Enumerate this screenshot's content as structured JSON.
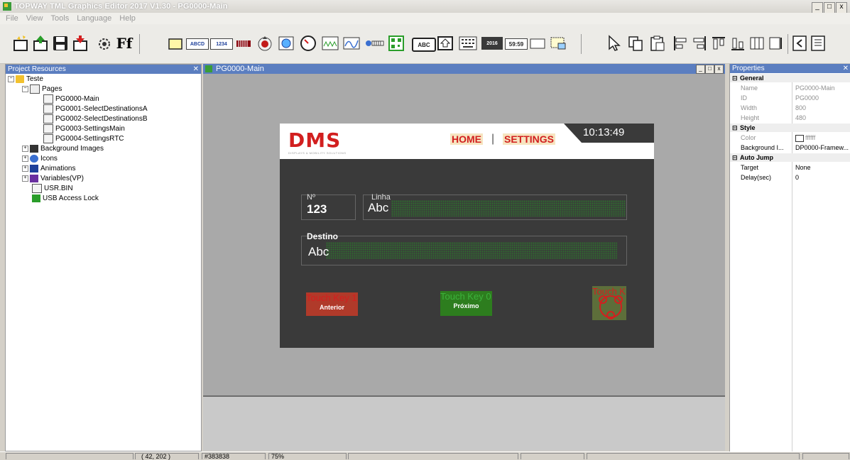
{
  "window": {
    "title": "TOPWAY TML Graphics Editor 2017 V1.30 - PG0000-Main",
    "controls": [
      "_",
      "□",
      "x"
    ]
  },
  "menu": [
    "File",
    "View",
    "Tools",
    "Language",
    "Help"
  ],
  "toolbar": {
    "icons": [
      "new-project-icon",
      "open-project-icon",
      "save-icon",
      "export-icon",
      "settings-icon",
      "font-icon",
      "rect-area-icon",
      "text-abcd-icon",
      "number-1234-icon",
      "bar-icon",
      "knob-icon",
      "touch-key-icon",
      "gauge-icon",
      "waveform-icon",
      "line-chart-icon",
      "slider-icon",
      "qr-icon",
      "abc-input-icon",
      "popup-key-icon",
      "keyboard-icon",
      "date-icon",
      "time-icon",
      "frame-icon",
      "select-area-icon",
      "pointer-icon",
      "copy-icon",
      "paste-icon",
      "align-left-icon",
      "align-right-icon",
      "align-top-icon",
      "align-bottom-icon",
      "distribute-icon",
      "size-icon",
      "order-icon",
      "more-icon"
    ],
    "text_abcd": "ABCD",
    "text_1234": "1234",
    "text_abc": "ABC",
    "text_2016": "2016",
    "text_5959": "59:59",
    "font_label": "Ff"
  },
  "project": {
    "title": "Project Resources",
    "pin": " ✕",
    "root": "Teste",
    "pages_label": "Pages",
    "pages": [
      "PG0000-Main",
      "PG0001-SelectDestinationsA",
      "PG0002-SelectDestinationsB",
      "PG0003-SettingsMain",
      "PG0004-SettingsRTC"
    ],
    "others": [
      "Background Images",
      "Icons",
      "Animations",
      "Variables(VP)",
      "USR.BIN",
      "USB Access Lock"
    ]
  },
  "editor": {
    "tab": "PG0000-Main",
    "screen": {
      "logo": "DMS",
      "logo_sub": "DISPLAYS & MOBILITY SOLUTIONS",
      "nav_home": "HOME",
      "nav_sep": "|",
      "nav_settings": "SETTINGS",
      "clock": "10:13:49",
      "num_label": "Nº",
      "num_value": "123",
      "line_label": "Linha",
      "line_value": "Abc",
      "dest_label": "Destino",
      "dest_value": "Abc",
      "touch_key_1": "Touch Key 1",
      "touch_key_0": "Touch Key 0",
      "touch_key_2": "Touch K",
      "btn_prev": "Anterior",
      "btn_next": "Próximo"
    }
  },
  "properties": {
    "title": "Properties",
    "pin": " ✕",
    "sections": [
      {
        "name": "General",
        "rows": [
          [
            "Name",
            "PG0000-Main"
          ],
          [
            "ID",
            "PG0000"
          ],
          [
            "Width",
            "800"
          ],
          [
            "Height",
            "480"
          ]
        ]
      },
      {
        "name": "Style",
        "rows": [
          [
            "Color",
            "ffffff"
          ],
          [
            "Background I...",
            "DP0000-Framew..."
          ]
        ]
      },
      {
        "name": "Auto Jump",
        "rows": [
          [
            "Target",
            "None"
          ],
          [
            "Delay(sec)",
            "0"
          ]
        ]
      }
    ]
  },
  "status": {
    "coords": "( 42, 202 )",
    "color": "#383838",
    "zoom": "75%"
  },
  "colors": {
    "accent": "#d21f1f",
    "green": "#3a9c38",
    "panel_header": "#5b7ec0"
  }
}
